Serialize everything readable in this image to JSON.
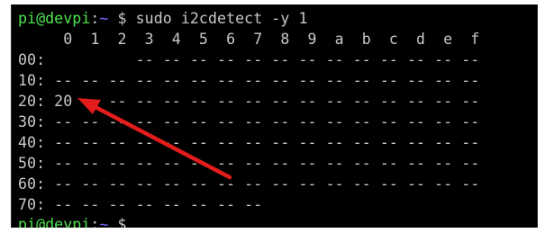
{
  "terminal": {
    "prompt1": {
      "user_host": "pi@devpi",
      "colon": ":",
      "path": "~",
      "symbol": " $ ",
      "command": "sudo i2cdetect -y 1"
    },
    "header": "     0  1  2  3  4  5  6  7  8  9  a  b  c  d  e  f",
    "rows": [
      "00:          -- -- -- -- -- -- -- -- -- -- -- -- --",
      "10: -- -- -- -- -- -- -- -- -- -- -- -- -- -- -- --",
      "20: 20 -- -- -- -- -- -- -- -- -- -- -- -- -- -- --",
      "30: -- -- -- -- -- -- -- -- -- -- -- -- -- -- -- --",
      "40: -- -- -- -- -- -- -- -- -- -- -- -- -- -- -- --",
      "50: -- -- -- -- -- -- -- -- -- -- -- -- -- -- -- --",
      "60: -- -- -- -- -- -- -- -- -- -- -- -- -- -- -- --",
      "70: -- -- -- -- -- -- -- --"
    ],
    "prompt2": {
      "user_host": "pi@devpi",
      "colon": ":",
      "path": "~",
      "symbol": " $ "
    }
  },
  "annotation": {
    "arrow_color": "#e41c1c",
    "points_to": "20"
  }
}
